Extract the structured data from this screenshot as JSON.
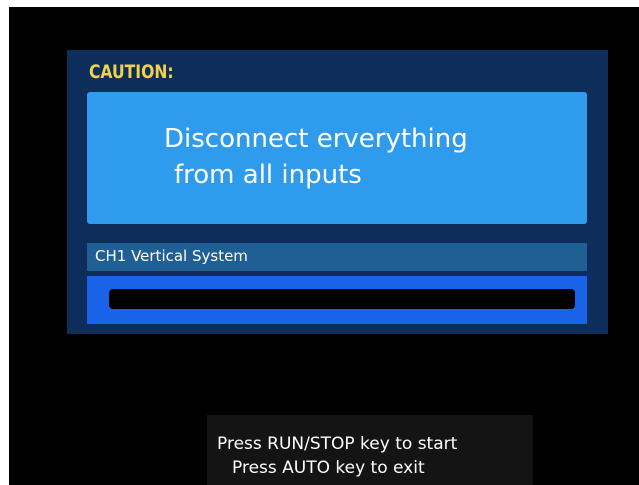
{
  "dialog": {
    "title": "CAUTION:",
    "message_lines": [
      "Disconnect erverything",
      "from all inputs"
    ]
  },
  "calibration": {
    "stage_label": "CH1 Vertical System",
    "progress": 0
  },
  "instructions": {
    "start_text": "Press RUN/STOP key to start",
    "exit_text": "Press AUTO key to exit"
  },
  "colors": {
    "screen_background": "#000000",
    "dialog_background": "#0d2d5a",
    "title_color": "#f2d24b",
    "message_box": "#2e9bec",
    "stage_bar": "#1f5f93",
    "progress_frame": "#1863e7",
    "progress_track": "#000000"
  }
}
